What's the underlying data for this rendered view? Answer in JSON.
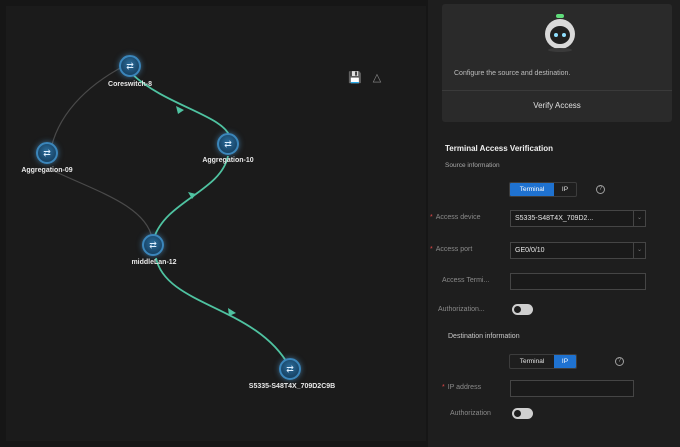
{
  "topology": {
    "toolbar": {
      "save_icon": "save-icon",
      "layout_icon": "layout-icon"
    },
    "nodes": [
      {
        "id": "core",
        "label": "Coreswitch-8"
      },
      {
        "id": "agg09",
        "label": "Aggregation-09"
      },
      {
        "id": "agg10",
        "label": "Aggregation-10"
      },
      {
        "id": "mid12",
        "label": "middleLan-12"
      },
      {
        "id": "access",
        "label": "S5335-S48T4X_709D2C9B"
      }
    ],
    "path_color": "#4fc3a1",
    "link_color": "#4a4a4a"
  },
  "panel": {
    "hero_text": "Configure the source and destination.",
    "verify_button": "Verify Access",
    "title": "Terminal Access Verification",
    "source_info": "Source information",
    "source_toggle": {
      "options": [
        "Terminal",
        "IP"
      ],
      "selected": "Terminal"
    },
    "access_device_label": "Access device",
    "access_device_value": "S5335-S48T4X_709D2...",
    "access_port_label": "Access port",
    "access_port_value": "GE0/0/10",
    "access_terminal_label": "Access Termi...",
    "access_terminal_value": "",
    "authorization_label": "Authorization...",
    "destination_info": "Destination information",
    "dest_toggle": {
      "options": [
        "Terminal",
        "IP"
      ],
      "selected": "IP"
    },
    "ip_address_label": "IP address",
    "ip_address_value": "",
    "dest_authorization_label": "Authorization",
    "accent_color": "#1f72d0"
  }
}
